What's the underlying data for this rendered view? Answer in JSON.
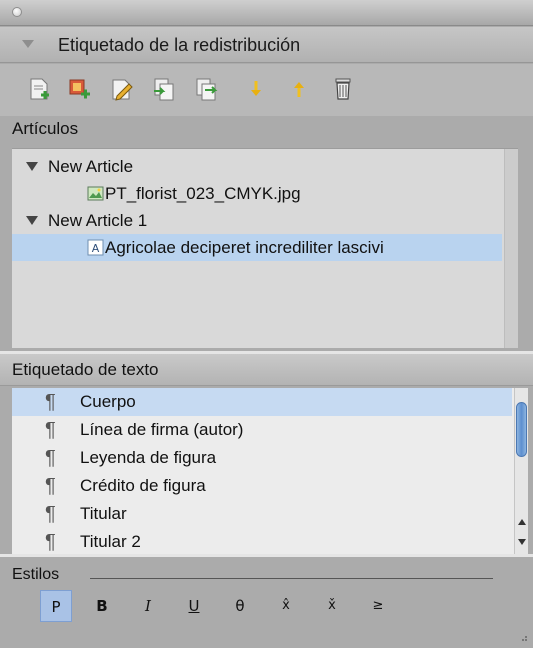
{
  "panel": {
    "title": "Etiquetado de la redistribución"
  },
  "toolbar": {
    "buttons": [
      {
        "icon": "new-article-icon"
      },
      {
        "icon": "add-selected-element-icon"
      },
      {
        "icon": "edit-icon"
      },
      {
        "icon": "import-icon"
      },
      {
        "icon": "export-icon"
      },
      {
        "icon": "move-down-icon"
      },
      {
        "icon": "move-up-icon"
      },
      {
        "icon": "trash-icon"
      }
    ]
  },
  "articles": {
    "label": "Artículos",
    "items": [
      {
        "label": "New Article",
        "level": 0,
        "expanded": true
      },
      {
        "label": "PT_florist_023_CMYK.jpg",
        "level": 1,
        "icon": "image-file-icon"
      },
      {
        "label": "New Article 1",
        "level": 0,
        "expanded": true
      },
      {
        "label": "Agricolae deciperet incrediliter lascivi",
        "level": 1,
        "icon": "text-frame-icon",
        "selected": true
      }
    ]
  },
  "text_tagging": {
    "label": "Etiquetado de texto",
    "items": [
      {
        "label": "Cuerpo",
        "selected": true
      },
      {
        "label": "Línea de firma (autor)"
      },
      {
        "label": "Leyenda de figura"
      },
      {
        "label": "Crédito de figura"
      },
      {
        "label": "Titular"
      },
      {
        "label": "Titular 2"
      }
    ]
  },
  "styles": {
    "label": "Estilos",
    "buttons": [
      {
        "label": "P",
        "active": true
      },
      {
        "label": "B"
      },
      {
        "label": "I"
      },
      {
        "label": "U"
      },
      {
        "label": "θ"
      },
      {
        "label": "x̂"
      },
      {
        "label": "x̌"
      },
      {
        "label": "≥"
      }
    ]
  },
  "colors": {
    "panel_bg": "#ababab",
    "selection": "#b9d3ef",
    "active_style": "#a9c2e6"
  }
}
